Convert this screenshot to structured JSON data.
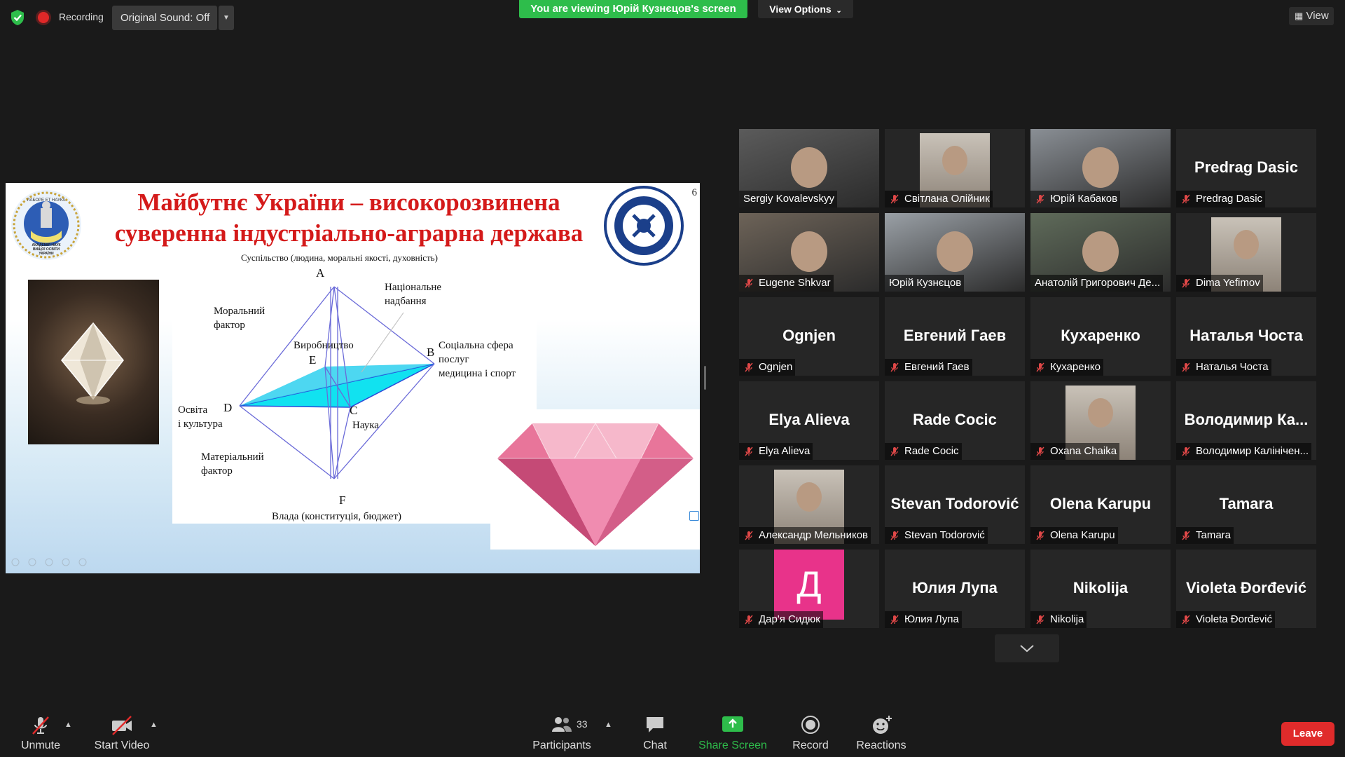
{
  "topbar": {
    "recording_label": "Recording",
    "sound_label": "Original Sound: Off",
    "viewing_banner": "You are viewing Юрій Кузнєцов's screen",
    "view_options_label": "View Options",
    "view_label": "View",
    "status_colors": {
      "secure": "#2ebd4b",
      "recording": "#e02828",
      "banner": "#2ebd4b"
    }
  },
  "slide": {
    "title_line1": "Майбутнє України – високорозвинена",
    "title_line2": "суверенна індустріально-аграрна держава",
    "page_number": "6",
    "logo_left_text": "ЛАБОРЕ ЕТ НАУКА",
    "logo_left_lines": [
      "АКАДЕМІЯ НАУК",
      "ВИЩОЇ ОСВІТИ",
      "УКРАЇНИ"
    ],
    "top_caption": "Суспільство (людина, моральні якості, духовність)",
    "bottom_caption": "Влада (конституція, бюджет)",
    "point_a": "A",
    "point_b": "B",
    "point_c": "C",
    "point_d": "D",
    "point_e": "E",
    "point_f": "F",
    "moral_1": "Моральний",
    "moral_2": "фактор",
    "national_1": "Національне",
    "national_2": "надбання",
    "production": "Виробництво",
    "social_1": "Соціальна сфера",
    "social_2": "послуг",
    "social_3": "медицина і спорт",
    "education_1": "Освіта",
    "education_2": "і культура",
    "science": "Наука",
    "material_1": "Матеріальний",
    "material_2": "фактор"
  },
  "gallery": {
    "tiles": [
      {
        "name": "Sergiy Kovalevskyy",
        "display": "",
        "muted": false,
        "video": true,
        "active": false
      },
      {
        "name": "Світлана Олійник",
        "display": "",
        "muted": true,
        "video": true,
        "active": false
      },
      {
        "name": "Юрій Кабаков",
        "display": "",
        "muted": true,
        "video": true,
        "active": false
      },
      {
        "name": "Predrag Dasic",
        "display": "Predrag Dasic",
        "muted": true,
        "video": false,
        "active": false
      },
      {
        "name": "Eugene Shkvar",
        "display": "",
        "muted": true,
        "video": true,
        "active": false
      },
      {
        "name": "Юрій Кузнєцов",
        "display": "",
        "muted": false,
        "video": true,
        "active": true
      },
      {
        "name": "Анатолій Григорович Де...",
        "display": "",
        "muted": false,
        "video": true,
        "active": false
      },
      {
        "name": "Dima Yefimov",
        "display": "",
        "muted": true,
        "video": true,
        "active": false
      },
      {
        "name": "Ognjen",
        "display": "Ognjen",
        "muted": true,
        "video": false,
        "active": false
      },
      {
        "name": "Евгений Гаев",
        "display": "Евгений Гаев",
        "muted": true,
        "video": false,
        "active": false
      },
      {
        "name": "Кухаренко",
        "display": "Кухаренко",
        "muted": true,
        "video": false,
        "active": false
      },
      {
        "name": "Наталья Чоста",
        "display": "Наталья Чоста",
        "muted": true,
        "video": false,
        "active": false
      },
      {
        "name": "Elya Alieva",
        "display": "Elya Alieva",
        "muted": true,
        "video": false,
        "active": false
      },
      {
        "name": "Rade Cocic",
        "display": "Rade Cocic",
        "muted": true,
        "video": false,
        "active": false
      },
      {
        "name": "Oxana Chaika",
        "display": "",
        "muted": true,
        "video": true,
        "active": false
      },
      {
        "name": "Володимир Калінічен...",
        "display": "Володимир Ка...",
        "muted": true,
        "video": false,
        "active": false
      },
      {
        "name": "Александр Мельников",
        "display": "",
        "muted": true,
        "video": true,
        "active": false
      },
      {
        "name": "Stevan Todorović",
        "display": "Stevan Todorović",
        "muted": true,
        "video": false,
        "active": false
      },
      {
        "name": "Olena Karupu",
        "display": "Olena Karupu",
        "muted": true,
        "video": false,
        "active": false
      },
      {
        "name": "Tamara",
        "display": "Tamara",
        "muted": true,
        "video": false,
        "active": false
      },
      {
        "name": "Дар'я Сидюк",
        "display": "Д",
        "muted": true,
        "video": false,
        "active": false
      },
      {
        "name": "Юлия Лупа",
        "display": "Юлия Лупа",
        "muted": true,
        "video": false,
        "active": false
      },
      {
        "name": "Nikolija",
        "display": "Nikolija",
        "muted": true,
        "video": false,
        "active": false
      },
      {
        "name": "Violeta Đorđević",
        "display": "Violeta Đorđević",
        "muted": true,
        "video": false,
        "active": false
      }
    ]
  },
  "toolbar": {
    "unmute_label": "Unmute",
    "start_video_label": "Start Video",
    "participants_label": "Participants",
    "participants_count": "33",
    "chat_label": "Chat",
    "share_label": "Share Screen",
    "record_label": "Record",
    "reactions_label": "Reactions",
    "leave_label": "Leave",
    "share_color": "#2ebd4b",
    "leave_color": "#e02b2b"
  }
}
